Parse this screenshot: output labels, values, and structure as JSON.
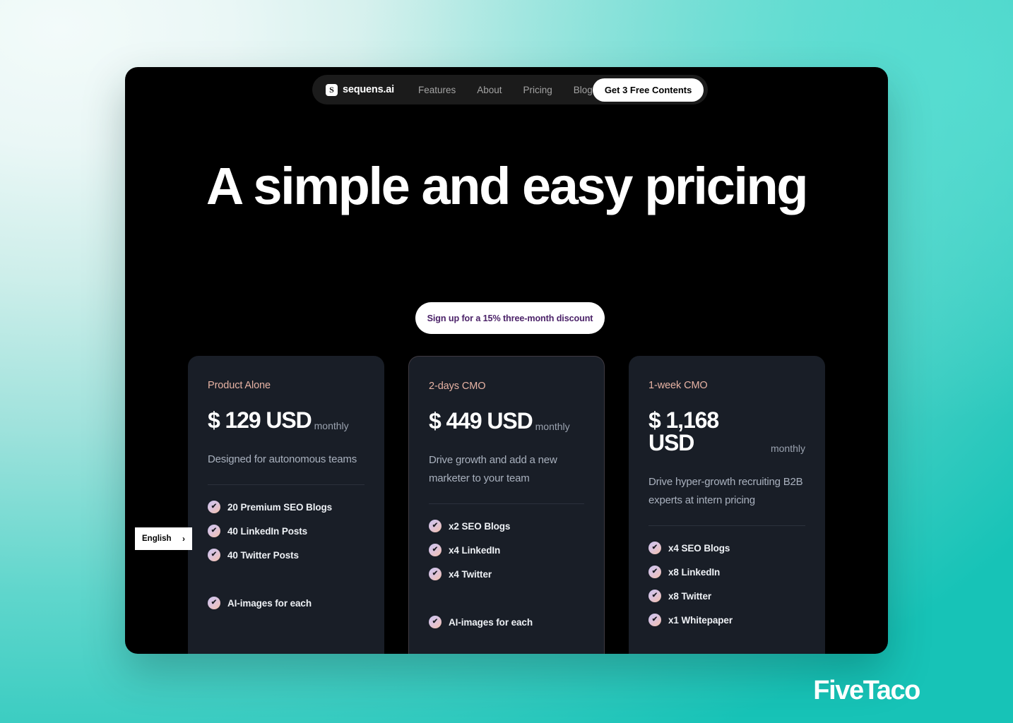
{
  "nav": {
    "brand": {
      "mark": "logo-icon",
      "name": "sequens.ai"
    },
    "links": [
      {
        "label": "Features"
      },
      {
        "label": "About"
      },
      {
        "label": "Pricing"
      },
      {
        "label": "Blog"
      }
    ],
    "cta": "Get 3 Free Contents"
  },
  "hero": {
    "title": "A simple and easy pricing",
    "discount_pill": "Sign up for a 15% three-month discount"
  },
  "pricing": {
    "plans": [
      {
        "name": "Product Alone",
        "price": "$ 129 USD",
        "period": "monthly",
        "description": "Designed for autonomous teams",
        "featured": false,
        "features": [
          {
            "label": "20 Premium SEO Blogs",
            "spaced": false
          },
          {
            "label": "40 LinkedIn Posts",
            "spaced": false
          },
          {
            "label": "40 Twitter Posts",
            "spaced": false
          },
          {
            "label": "AI-images for each",
            "spaced": true
          }
        ]
      },
      {
        "name": "2-days CMO",
        "price": "$ 449 USD",
        "period": "monthly",
        "description": "Drive growth and add a new marketer to your team",
        "featured": true,
        "features": [
          {
            "label": "x2 SEO Blogs",
            "spaced": false
          },
          {
            "label": "x4 LinkedIn",
            "spaced": false
          },
          {
            "label": "x4 Twitter",
            "spaced": false
          },
          {
            "label": "AI-images for each",
            "spaced": true
          }
        ]
      },
      {
        "name": "1-week CMO",
        "price": "$ 1,168 USD",
        "period": "monthly",
        "description": "Drive hyper-growth recruiting B2B experts at intern pricing",
        "featured": false,
        "features": [
          {
            "label": "x4 SEO Blogs",
            "spaced": false
          },
          {
            "label": "x8 LinkedIn",
            "spaced": false
          },
          {
            "label": "x8 Twitter",
            "spaced": false
          },
          {
            "label": "x1 Whitepaper",
            "spaced": false
          }
        ]
      }
    ]
  },
  "language_selector": {
    "label": "English",
    "chevron": "chevron-right-icon"
  },
  "watermark": "FiveTaco",
  "colors": {
    "accent_teal": "#17c3b7",
    "card_bg": "#191e27",
    "plan_name": "#e7b3a4",
    "pill_text": "#4b2268",
    "check_gradient_start": "#cdc6ef",
    "check_gradient_end": "#f4c1ac"
  }
}
